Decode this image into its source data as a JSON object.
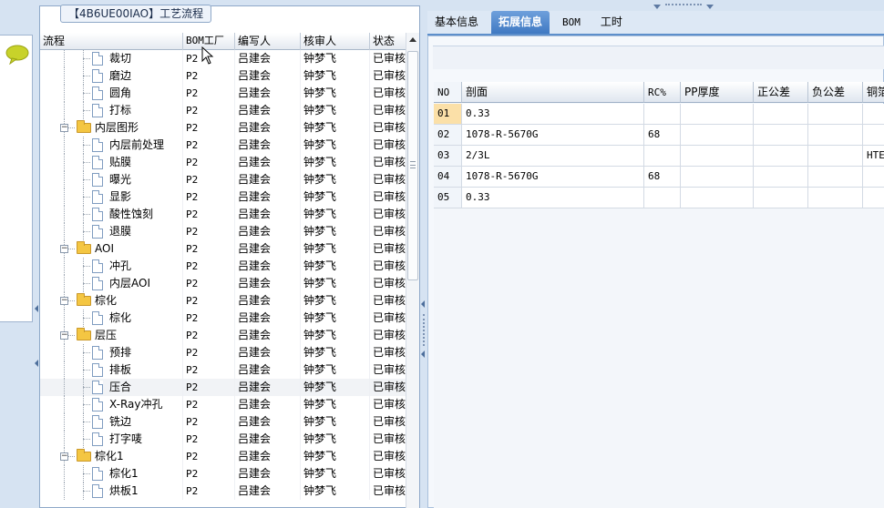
{
  "tree_panel": {
    "caption": "【4B6UE00IAO】工艺流程",
    "columns": [
      "流程",
      "BOM工厂",
      "编写人",
      "核审人",
      "状态"
    ],
    "rows": [
      {
        "name": "裁切",
        "level": 2,
        "type": "doc",
        "bom": "P2",
        "writer": "吕建会",
        "reviewer": "钟梦飞",
        "status": "已审核"
      },
      {
        "name": "磨边",
        "level": 2,
        "type": "doc",
        "bom": "P2",
        "writer": "吕建会",
        "reviewer": "钟梦飞",
        "status": "已审核"
      },
      {
        "name": "圆角",
        "level": 2,
        "type": "doc",
        "bom": "P2",
        "writer": "吕建会",
        "reviewer": "钟梦飞",
        "status": "已审核"
      },
      {
        "name": "打标",
        "level": 2,
        "type": "doc",
        "bom": "P2",
        "writer": "吕建会",
        "reviewer": "钟梦飞",
        "status": "已审核"
      },
      {
        "name": "内层图形",
        "level": 1,
        "type": "folder",
        "bom": "P2",
        "writer": "吕建会",
        "reviewer": "钟梦飞",
        "status": "已审核"
      },
      {
        "name": "内层前处理",
        "level": 2,
        "type": "doc",
        "bom": "P2",
        "writer": "吕建会",
        "reviewer": "钟梦飞",
        "status": "已审核"
      },
      {
        "name": "贴膜",
        "level": 2,
        "type": "doc",
        "bom": "P2",
        "writer": "吕建会",
        "reviewer": "钟梦飞",
        "status": "已审核"
      },
      {
        "name": "曝光",
        "level": 2,
        "type": "doc",
        "bom": "P2",
        "writer": "吕建会",
        "reviewer": "钟梦飞",
        "status": "已审核"
      },
      {
        "name": "显影",
        "level": 2,
        "type": "doc",
        "bom": "P2",
        "writer": "吕建会",
        "reviewer": "钟梦飞",
        "status": "已审核"
      },
      {
        "name": "酸性蚀刻",
        "level": 2,
        "type": "doc",
        "bom": "P2",
        "writer": "吕建会",
        "reviewer": "钟梦飞",
        "status": "已审核"
      },
      {
        "name": "退膜",
        "level": 2,
        "type": "doc",
        "bom": "P2",
        "writer": "吕建会",
        "reviewer": "钟梦飞",
        "status": "已审核"
      },
      {
        "name": "AOI",
        "level": 1,
        "type": "folder",
        "bom": "P2",
        "writer": "吕建会",
        "reviewer": "钟梦飞",
        "status": "已审核"
      },
      {
        "name": "冲孔",
        "level": 2,
        "type": "doc",
        "bom": "P2",
        "writer": "吕建会",
        "reviewer": "钟梦飞",
        "status": "已审核"
      },
      {
        "name": "内层AOI",
        "level": 2,
        "type": "doc",
        "bom": "P2",
        "writer": "吕建会",
        "reviewer": "钟梦飞",
        "status": "已审核"
      },
      {
        "name": "棕化",
        "level": 1,
        "type": "folder",
        "bom": "P2",
        "writer": "吕建会",
        "reviewer": "钟梦飞",
        "status": "已审核"
      },
      {
        "name": "棕化",
        "level": 2,
        "type": "doc",
        "bom": "P2",
        "writer": "吕建会",
        "reviewer": "钟梦飞",
        "status": "已审核"
      },
      {
        "name": "层压",
        "level": 1,
        "type": "folder",
        "bom": "P2",
        "writer": "吕建会",
        "reviewer": "钟梦飞",
        "status": "已审核"
      },
      {
        "name": "预排",
        "level": 2,
        "type": "doc",
        "bom": "P2",
        "writer": "吕建会",
        "reviewer": "钟梦飞",
        "status": "已审核"
      },
      {
        "name": "排板",
        "level": 2,
        "type": "doc",
        "bom": "P2",
        "writer": "吕建会",
        "reviewer": "钟梦飞",
        "status": "已审核"
      },
      {
        "name": "压合",
        "level": 2,
        "type": "doc",
        "bom": "P2",
        "writer": "吕建会",
        "reviewer": "钟梦飞",
        "status": "已审核",
        "selected": true
      },
      {
        "name": "X-Ray冲孔",
        "level": 2,
        "type": "doc",
        "bom": "P2",
        "writer": "吕建会",
        "reviewer": "钟梦飞",
        "status": "已审核"
      },
      {
        "name": "铣边",
        "level": 2,
        "type": "doc",
        "bom": "P2",
        "writer": "吕建会",
        "reviewer": "钟梦飞",
        "status": "已审核"
      },
      {
        "name": "打字唛",
        "level": 2,
        "type": "doc",
        "bom": "P2",
        "writer": "吕建会",
        "reviewer": "钟梦飞",
        "status": "已审核"
      },
      {
        "name": "棕化1",
        "level": 1,
        "type": "folder",
        "bom": "P2",
        "writer": "吕建会",
        "reviewer": "钟梦飞",
        "status": "已审核"
      },
      {
        "name": "棕化1",
        "level": 2,
        "type": "doc",
        "bom": "P2",
        "writer": "吕建会",
        "reviewer": "钟梦飞",
        "status": "已审核"
      },
      {
        "name": "烘板1",
        "level": 2,
        "type": "doc",
        "bom": "P2",
        "writer": "吕建会",
        "reviewer": "钟梦飞",
        "status": "已审核"
      }
    ]
  },
  "right_panel": {
    "tabs": [
      {
        "label": "基本信息",
        "active": false
      },
      {
        "label": "拓展信息",
        "active": true
      },
      {
        "label": "BOM",
        "active": false
      },
      {
        "label": "工时",
        "active": false
      }
    ],
    "grid": {
      "columns": [
        "NO",
        "剖面",
        "RC%",
        "PP厚度",
        "正公差",
        "负公差",
        "铜箔"
      ],
      "rows": [
        {
          "no": "01",
          "section": "0.33",
          "rc": "",
          "pp": "",
          "pos": "",
          "neg": "",
          "cu": "",
          "current": true
        },
        {
          "no": "02",
          "section": "1078-R-5670G",
          "rc": "68",
          "pp": "",
          "pos": "",
          "neg": "",
          "cu": ""
        },
        {
          "no": "03",
          "section": "2/3L",
          "rc": "",
          "pp": "",
          "pos": "",
          "neg": "",
          "cu": "HTE"
        },
        {
          "no": "04",
          "section": "1078-R-5670G",
          "rc": "68",
          "pp": "",
          "pos": "",
          "neg": "",
          "cu": ""
        },
        {
          "no": "05",
          "section": "0.33",
          "rc": "",
          "pp": "",
          "pos": "",
          "neg": "",
          "cu": ""
        }
      ]
    }
  },
  "colors": {
    "accent": "#3f79c2",
    "folder": "#f4c642",
    "current_row": "#fbe0a8",
    "window_bg": "#d6e3f2"
  },
  "icons": [
    "chat-bubble-icon",
    "folder-icon",
    "document-icon",
    "expander-icon",
    "mouse-cursor-icon",
    "scroll-up-icon"
  ]
}
